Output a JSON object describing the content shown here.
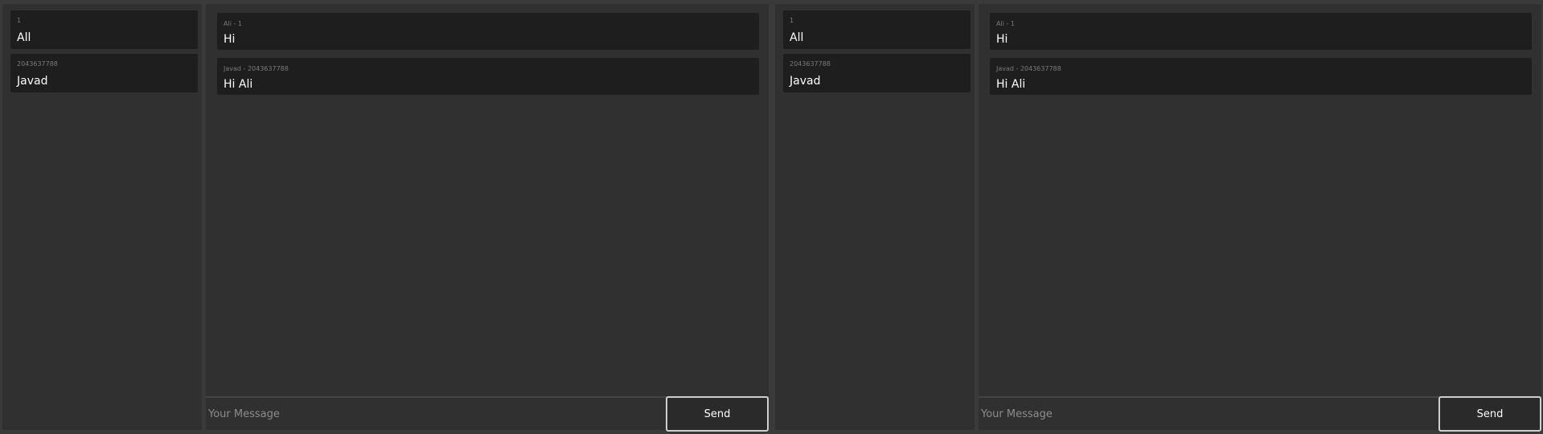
{
  "clients": [
    {
      "contacts": [
        {
          "id": "1",
          "name": "All"
        },
        {
          "id": "2043637788",
          "name": "Javad"
        }
      ],
      "messages": [
        {
          "meta": "Ali - 1",
          "text": "Hi"
        },
        {
          "meta": "Javad - 2043637788",
          "text": "Hi Ali"
        }
      ],
      "composer": {
        "placeholder": "Your Message",
        "send_label": "Send"
      }
    },
    {
      "contacts": [
        {
          "id": "1",
          "name": "All"
        },
        {
          "id": "2043637788",
          "name": "Javad"
        }
      ],
      "messages": [
        {
          "meta": "Ali - 1",
          "text": "Hi"
        },
        {
          "meta": "Javad - 2043637788",
          "text": "Hi Ali"
        }
      ],
      "composer": {
        "placeholder": "Your Message",
        "send_label": "Send"
      }
    }
  ]
}
